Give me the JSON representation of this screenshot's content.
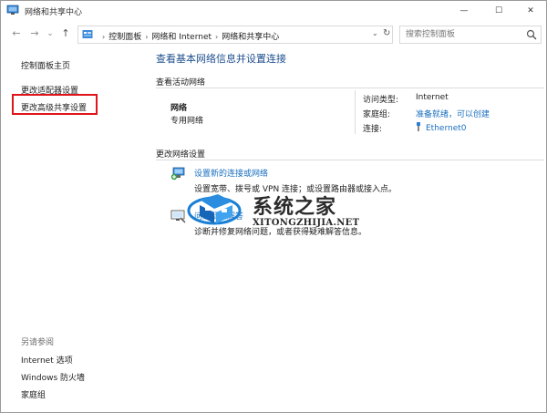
{
  "window": {
    "title": "网络和共享中心",
    "controls": {
      "minimize": "—",
      "maximize": "☐",
      "close": "✕"
    }
  },
  "nav": {
    "back": "←",
    "forward": "→",
    "history": "⌄",
    "up": "↑",
    "breadcrumbs": [
      "控制面板",
      "网络和 Internet",
      "网络和共享中心"
    ],
    "dropdown": "⌄",
    "refresh": "↻",
    "search_placeholder": "搜索控制面板"
  },
  "sidebar": {
    "home": "控制面板主页",
    "items": [
      "更改适配器设置",
      "更改高级共享设置"
    ],
    "see_also_title": "另请参阅",
    "see_also": [
      "Internet 选项",
      "Windows 防火墙",
      "家庭组"
    ]
  },
  "main": {
    "page_title": "查看基本网络信息并设置连接",
    "active_networks_title": "查看活动网络",
    "network": {
      "name": "网络",
      "category": "专用网络"
    },
    "details": [
      {
        "key": "访问类型:",
        "value": "Internet",
        "link": false
      },
      {
        "key": "家庭组:",
        "value": "准备就绪，可以创建",
        "link": true
      },
      {
        "key": "连接:",
        "value": "Ethernet0",
        "link": true
      }
    ],
    "change_settings_title": "更改网络设置",
    "tasks": [
      {
        "link": "设置新的连接或网络",
        "desc": "设置宽带、拨号或 VPN 连接；或设置路由器或接入点。"
      },
      {
        "link": "问题疑难解答",
        "desc": "诊断并修复网络问题，或者获得疑难解答信息。"
      }
    ]
  },
  "watermark": {
    "cn": "系统之家",
    "en": "XITONGZHIJIA.NET"
  },
  "colors": {
    "link": "#1a6fbf",
    "title": "#1f4f8e",
    "highlight_box": "#e0151b"
  }
}
